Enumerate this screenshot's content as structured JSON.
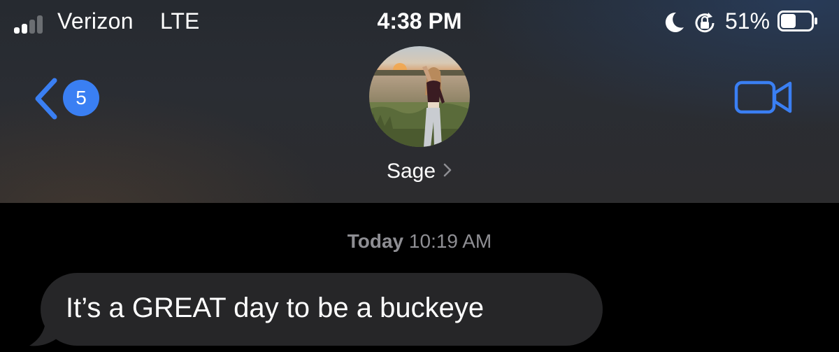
{
  "status_bar": {
    "carrier": "Verizon",
    "network": "LTE",
    "time": "4:38 PM",
    "battery_percent": "51%",
    "signal_bars_active": 2,
    "signal_bars_total": 4,
    "battery_level": 0.51,
    "icons": [
      "signal-icon",
      "moon-icon",
      "rotation-lock-icon",
      "battery-icon"
    ]
  },
  "nav": {
    "back_icon": "chevron-left-icon",
    "unread_count": "5",
    "video_icon": "video-camera-icon",
    "accent_color": "#3a7ff3"
  },
  "contact": {
    "name": "Sage",
    "chevron": "›",
    "avatar_icon": "contact-photo"
  },
  "conversation": {
    "timestamp_day": "Today",
    "timestamp_time": "10:19 AM",
    "messages": [
      {
        "direction": "incoming",
        "text": "It’s a GREAT day to be a buckeye"
      }
    ]
  }
}
